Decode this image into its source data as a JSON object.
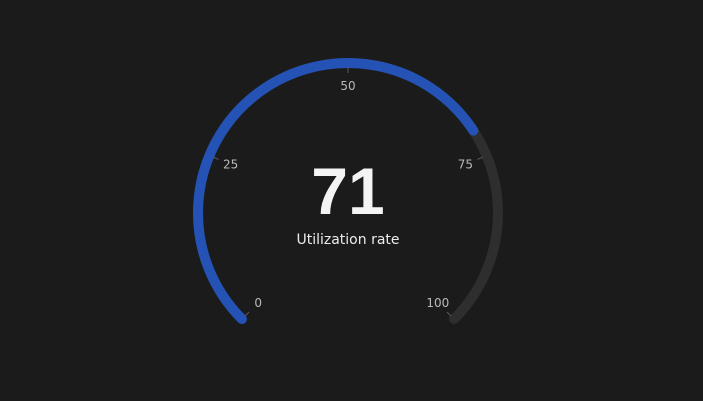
{
  "chart_data": {
    "type": "gauge",
    "value": 71,
    "label": "Utilization rate",
    "min": 0,
    "max": 100,
    "ticks": [
      {
        "value": 0,
        "label": "0"
      },
      {
        "value": 25,
        "label": "25"
      },
      {
        "value": 50,
        "label": "50"
      },
      {
        "value": 75,
        "label": "75"
      },
      {
        "value": 100,
        "label": "100"
      }
    ],
    "colors": {
      "background": "#1b1b1b",
      "value_arc": "#2452b5",
      "track": "#2e2e2e"
    }
  }
}
